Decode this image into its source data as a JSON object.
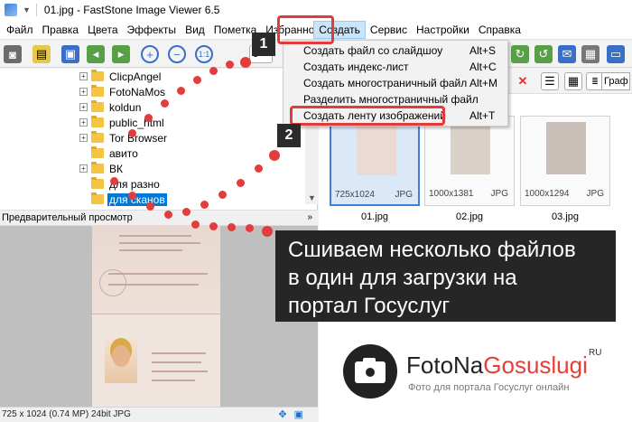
{
  "window": {
    "title": "01.jpg  -  FastStone Image Viewer 6.5"
  },
  "menu": {
    "items": [
      "Файл",
      "Правка",
      "Цвета",
      "Эффекты",
      "Вид",
      "Пометка",
      "Избранное",
      "Создать",
      "Сервис",
      "Настройки",
      "Справка"
    ],
    "active": "Создать"
  },
  "toolbar": {
    "zoom_partial": "3"
  },
  "create_menu": {
    "items": [
      {
        "label": "Создать файл со слайдшоу",
        "shortcut": "Alt+S"
      },
      {
        "label": "Создать индекс-лист",
        "shortcut": "Alt+C"
      },
      {
        "label": "Создать многостраничный файл",
        "shortcut": "Alt+M"
      },
      {
        "label": "Разделить многостраничный файл",
        "shortcut": ""
      },
      {
        "label": "Создать ленту изображений",
        "shortcut": "Alt+T"
      }
    ],
    "highlighted_index": 4
  },
  "folder_tree": {
    "items": [
      {
        "label": "ClicpAngel",
        "expandable": true
      },
      {
        "label": "FotoNaMos",
        "expandable": true
      },
      {
        "label": "koldun",
        "expandable": true
      },
      {
        "label": "public_html",
        "expandable": true
      },
      {
        "label": "Tor Browser",
        "expandable": true
      },
      {
        "label": "авито",
        "expandable": false
      },
      {
        "label": "ВК",
        "expandable": true
      },
      {
        "label": "для разно",
        "expandable": false
      },
      {
        "label": "для сканов",
        "expandable": false,
        "selected": true
      }
    ]
  },
  "preview": {
    "header": "Предварительный просмотр"
  },
  "status_bar": {
    "text": "725 x 1024 (0.74 MP)  24bit  JPG"
  },
  "thumbnails": [
    {
      "name": "01.jpg",
      "dims": "725x1024",
      "type": "JPG",
      "selected": true
    },
    {
      "name": "02.jpg",
      "dims": "1000x1381",
      "type": "JPG",
      "selected": false
    },
    {
      "name": "03.jpg",
      "dims": "1000x1294",
      "type": "JPG",
      "selected": false
    }
  ],
  "right_toolbar": {
    "combo_partial": "Граф"
  },
  "annotations": {
    "badge_1": "1",
    "badge_2": "2",
    "banner_lines": [
      "Сшиваем несколько файлов",
      "в один для загрузки на",
      "портал Госуслуг"
    ],
    "accent_color": "#e23b3b"
  },
  "logo": {
    "brand_part1": "FotoNa",
    "brand_part2": "Gosuslugi",
    "tld": "RU",
    "tagline": "Фото для портала Госуслуг онлайн"
  }
}
